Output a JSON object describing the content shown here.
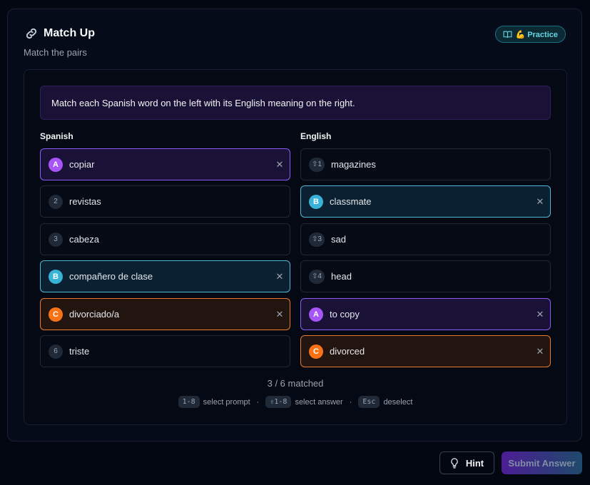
{
  "header": {
    "title": "Match Up",
    "subtitle": "Match the pairs",
    "badge": "💪 Practice"
  },
  "instruction": "Match each Spanish word on the left with its English meaning on the right.",
  "left": {
    "heading": "Spanish",
    "items": [
      {
        "marker": "A",
        "label": "copiar",
        "match": "a"
      },
      {
        "marker": "2",
        "label": "revistas",
        "match": ""
      },
      {
        "marker": "3",
        "label": "cabeza",
        "match": ""
      },
      {
        "marker": "B",
        "label": "compañero de clase",
        "match": "b"
      },
      {
        "marker": "C",
        "label": "divorciado/a",
        "match": "c"
      },
      {
        "marker": "6",
        "label": "triste",
        "match": ""
      }
    ]
  },
  "right": {
    "heading": "English",
    "items": [
      {
        "marker": "⇧1",
        "label": "magazines",
        "match": ""
      },
      {
        "marker": "B",
        "label": "classmate",
        "match": "b"
      },
      {
        "marker": "⇧3",
        "label": "sad",
        "match": ""
      },
      {
        "marker": "⇧4",
        "label": "head",
        "match": ""
      },
      {
        "marker": "A",
        "label": "to copy",
        "match": "a"
      },
      {
        "marker": "C",
        "label": "divorced",
        "match": "c"
      }
    ]
  },
  "status": "3 / 6 matched",
  "shortcuts": {
    "key1": "1-8",
    "text1": "select prompt",
    "key2": "⇧1-8",
    "text2": "select answer",
    "key3": "Esc",
    "text3": "deselect",
    "separator": "·"
  },
  "buttons": {
    "hint": "Hint",
    "submit": "Submit Answer"
  },
  "colors": {
    "match_a": "#a855f7",
    "match_b": "#38b2d6",
    "match_c": "#f97316"
  }
}
